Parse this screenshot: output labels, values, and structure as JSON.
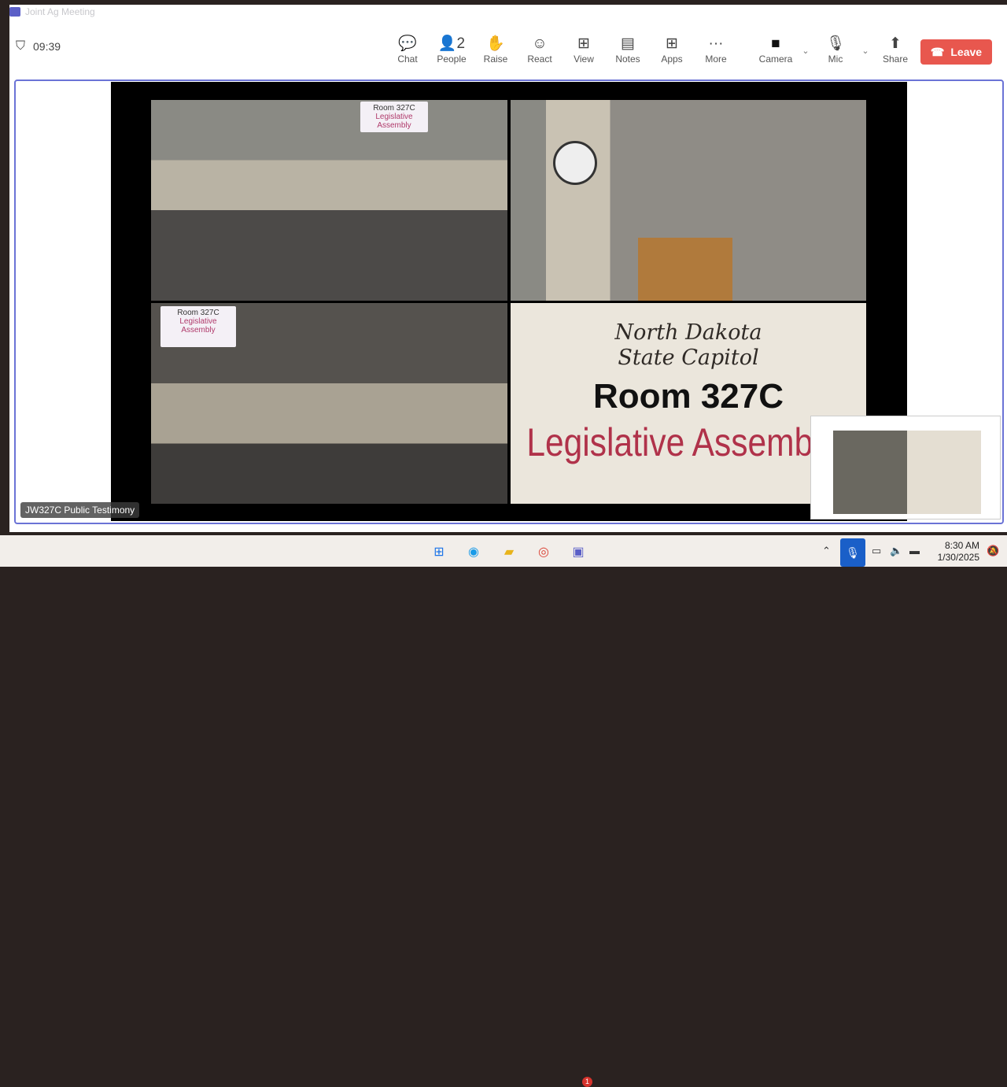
{
  "window": {
    "title": "Joint Ag Meeting",
    "timer": "09:39"
  },
  "toolbar": {
    "items": [
      {
        "label": "Chat",
        "icon": "chat-icon",
        "glyph": "💬"
      },
      {
        "label": "People",
        "icon": "people-icon",
        "glyph": "👤2"
      },
      {
        "label": "Raise",
        "icon": "hand-icon",
        "glyph": "✋"
      },
      {
        "label": "React",
        "icon": "smiley-icon",
        "glyph": "☺"
      },
      {
        "label": "View",
        "icon": "grid-icon",
        "glyph": "⊞"
      },
      {
        "label": "Notes",
        "icon": "notes-icon",
        "glyph": "▤"
      },
      {
        "label": "Apps",
        "icon": "plus-icon",
        "glyph": "⊞"
      },
      {
        "label": "More",
        "icon": "more-icon",
        "glyph": "···"
      },
      {
        "label": "Camera",
        "icon": "camera-icon",
        "glyph": "■"
      },
      {
        "label": "Mic",
        "icon": "mic-icon",
        "glyph": "🎙"
      },
      {
        "label": "Share",
        "icon": "share-icon",
        "glyph": "⬆"
      }
    ],
    "leave": "Leave"
  },
  "video": {
    "sign1_room": "Room 327C",
    "sign1_name": "Legislative Assembly",
    "sign2_room": "Room 327C",
    "sign2_name": "Legislative Assembly",
    "slide_line1": "North Dakota",
    "slide_line2": "State Capitol",
    "slide_room": "Room 327C",
    "slide_title": "Legislative Assembly"
  },
  "participant_label": "JW327C Public Testimony",
  "taskbar": {
    "time": "8:30 AM",
    "date": "1/30/2025",
    "teams_badge": "1"
  },
  "colors": {
    "accent": "#6b73d6",
    "leave": "#e8574e"
  }
}
